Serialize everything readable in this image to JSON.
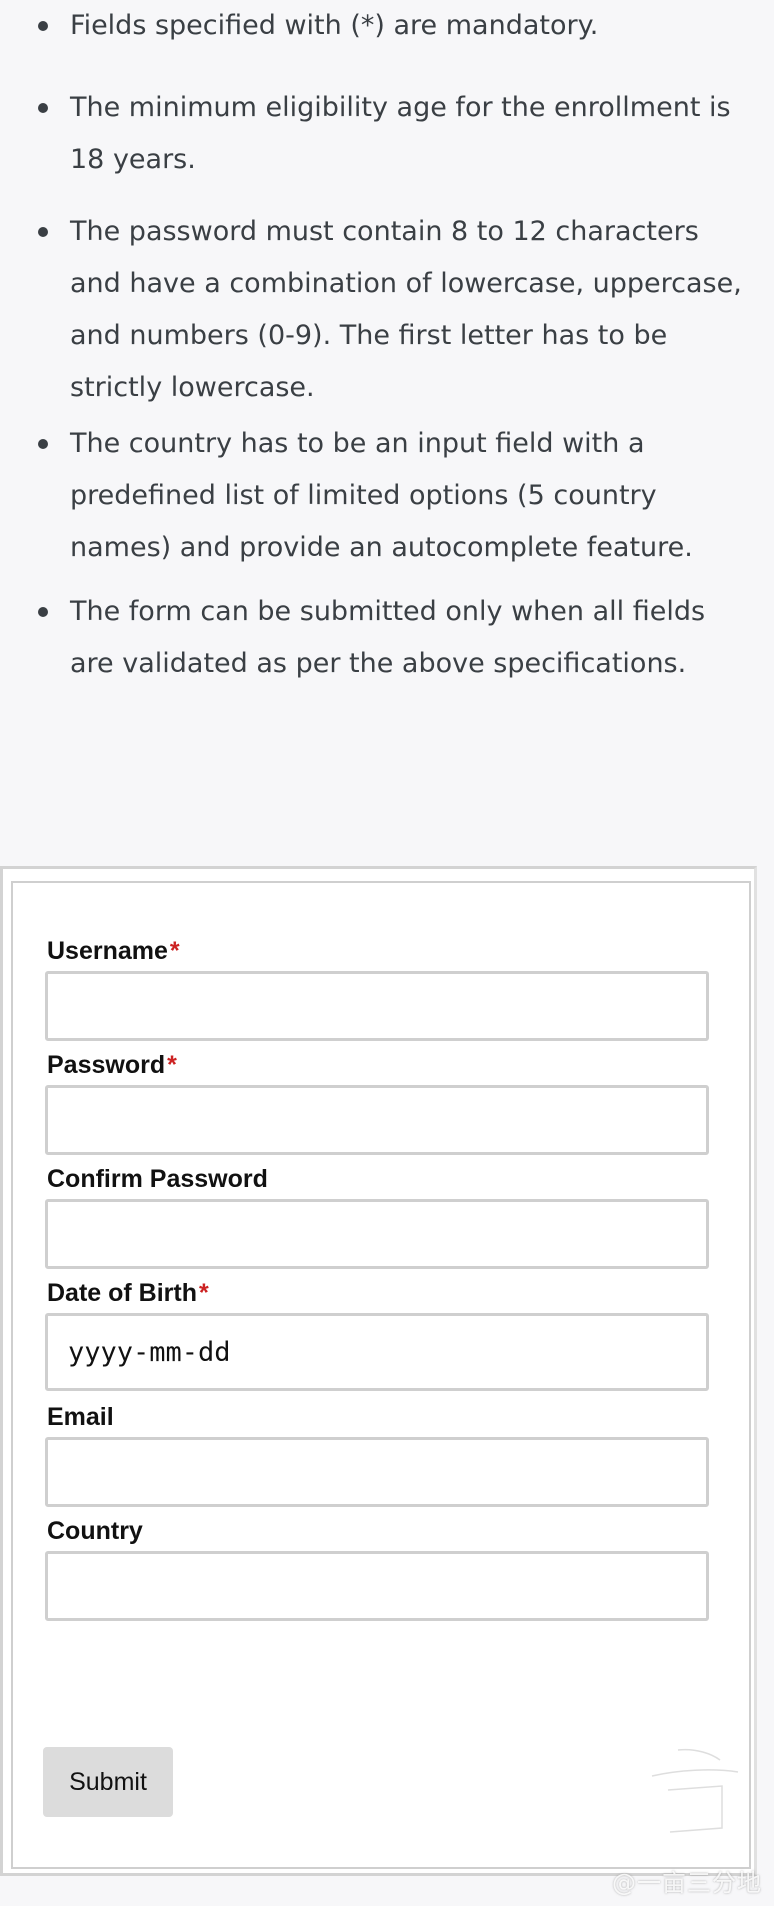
{
  "requirements": [
    "Fields specified with (*) are mandatory.",
    "The minimum eligibility age for the enrollment is 18 years.",
    "The password must contain 8 to 12 characters and have a combination of lowercase, uppercase, and numbers (0-9). The first letter has to be strictly lowercase.",
    "The country has to be an input field with a predefined list of limited options (5 country names) and provide an autocomplete feature.",
    "The form can be submitted only when all fields are validated as per the above specifications."
  ],
  "form": {
    "required_marker": "*",
    "fields": [
      {
        "label": "Username",
        "required": true,
        "value": "",
        "placeholder": ""
      },
      {
        "label": "Password",
        "required": true,
        "value": "",
        "placeholder": ""
      },
      {
        "label": "Confirm Password",
        "required": false,
        "value": "",
        "placeholder": ""
      },
      {
        "label": "Date of Birth",
        "required": true,
        "value": "",
        "placeholder": "yyyy-mm-dd"
      },
      {
        "label": "Email",
        "required": false,
        "value": "",
        "placeholder": ""
      },
      {
        "label": "Country",
        "required": false,
        "value": "",
        "placeholder": ""
      }
    ],
    "submit_label": "Submit"
  },
  "watermark": {
    "text": "@一亩三分地",
    "icon": "seal-logo-icon"
  },
  "colors": {
    "page_bg": "#f7f7f9",
    "text": "#3a3f44",
    "required_star": "#cc2222",
    "button_bg": "#dcdcdc"
  }
}
